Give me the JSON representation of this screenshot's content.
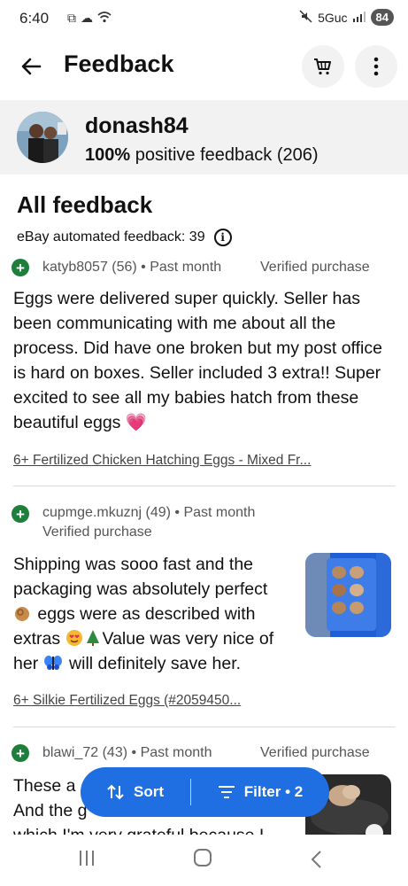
{
  "status_bar": {
    "time": "6:40",
    "network": "5Guc",
    "battery": "84"
  },
  "header": {
    "title": "Feedback"
  },
  "seller": {
    "username": "donash84",
    "percent": "100%",
    "rating_rest": "positive feedback (206)"
  },
  "section": {
    "title": "All feedback",
    "automated": "eBay automated feedback: 39"
  },
  "feedback": [
    {
      "user": "katyb8057 (56)",
      "time": "Past month",
      "verified": "Verified purchase",
      "text": "Eggs were delivered super quickly. Seller has been communicating with me about all the process. Did have one broken but my post office is hard on boxes. Seller included 3 extra!! Super excited to see all my babies hatch from these beautiful eggs",
      "emoji": "💗",
      "item": "6+ Fertilized Chicken Hatching Eggs - Mixed Fr..."
    },
    {
      "user": "cupmge.mkuznj (49)",
      "time": "Past month",
      "verified": "Verified purchase",
      "line1": "Shipping was sooo fast and the",
      "line2": "packaging was absolutely perfect",
      "line3": "eggs were as described with",
      "line4a": "extras",
      "line4b": "Value was very nice of",
      "line5a": "her",
      "line5b": "will definitely save her.",
      "item": "6+ Silkie Fertilized Eggs (#2059450..."
    },
    {
      "user": "blawi_72 (43)",
      "time": "Past month",
      "verified": "Verified purchase",
      "line1": "These a",
      "line2": "And the g",
      "line3": "which I'm very grateful because I"
    }
  ],
  "actions": {
    "sort": "Sort",
    "filter": "Filter • 2"
  },
  "colors": {
    "accent": "#1f6fe3",
    "positive": "#1e7f3b",
    "seller_bg": "#f2f2f2"
  }
}
